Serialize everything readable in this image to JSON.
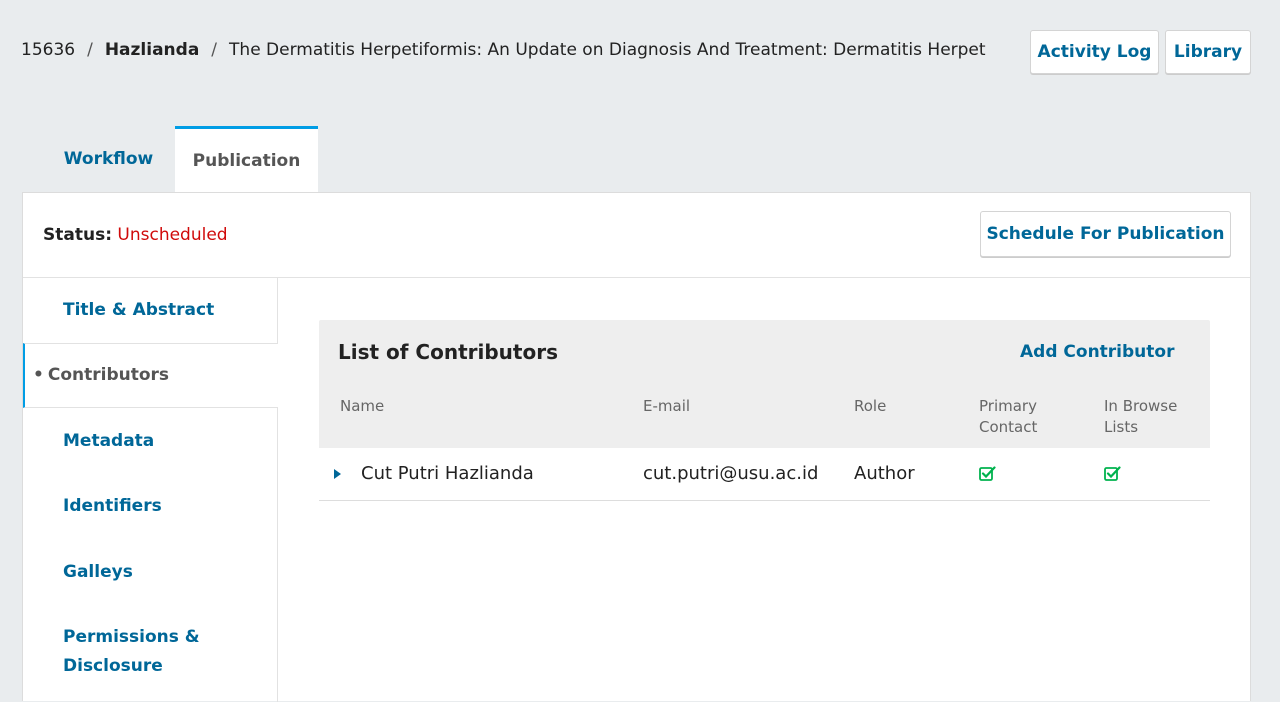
{
  "breadcrumb": {
    "id": "15636",
    "author": "Hazlianda",
    "title": "The Dermatitis Herpetiformis: An Update on Diagnosis And Treatment: Dermatitis Herpet",
    "separator": "/"
  },
  "header": {
    "activity_log_label": "Activity Log",
    "library_label": "Library"
  },
  "tabs": [
    {
      "label": "Workflow",
      "active": false
    },
    {
      "label": "Publication",
      "active": true
    }
  ],
  "status": {
    "label": "Status:",
    "value": "Unscheduled",
    "schedule_label": "Schedule For Publication"
  },
  "sidenav": [
    {
      "label": "Title & Abstract",
      "active": false
    },
    {
      "label": "Contributors",
      "active": true,
      "bullet": "•"
    },
    {
      "label": "Metadata",
      "active": false
    },
    {
      "label": "Identifiers",
      "active": false
    },
    {
      "label": "Galleys",
      "active": false
    },
    {
      "label": "Permissions &",
      "label2": "Disclosure",
      "active": false
    }
  ],
  "contributors": {
    "title": "List of Contributors",
    "add_label": "Add Contributor",
    "columns": {
      "name": "Name",
      "email": "E-mail",
      "role": "Role",
      "primary_1": "Primary",
      "primary_2": "Contact",
      "browse_1": "In Browse",
      "browse_2": "Lists"
    },
    "rows": [
      {
        "name": "Cut Putri Hazlianda",
        "email": "cut.putri@usu.ac.id",
        "role": "Author",
        "primary_contact": true,
        "in_browse_lists": true
      }
    ]
  },
  "colors": {
    "link": "#006798",
    "accent": "#009de5",
    "status_unscheduled": "#d00a0a",
    "check": "#00b24e"
  }
}
